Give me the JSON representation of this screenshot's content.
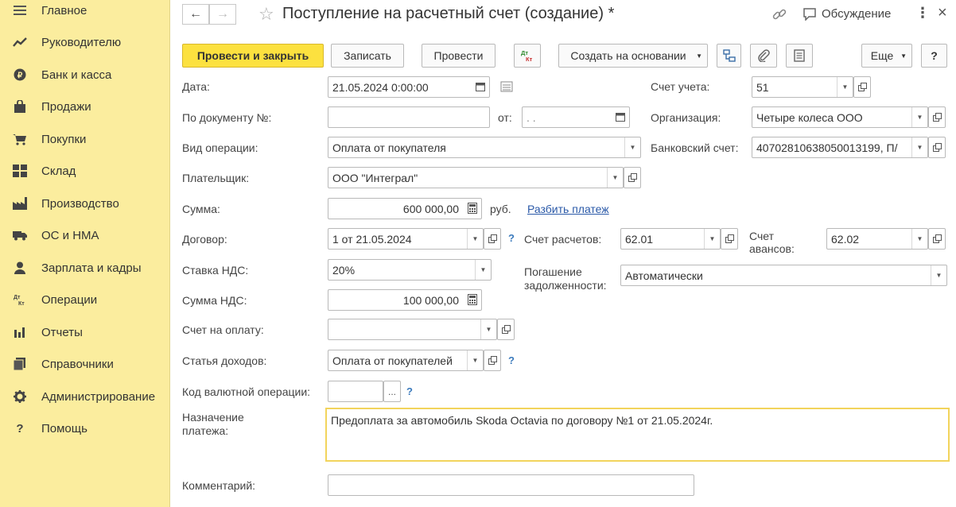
{
  "sidebar": {
    "items": [
      {
        "label": "Главное",
        "icon": "menu-icon"
      },
      {
        "label": "Руководителю",
        "icon": "trend-icon"
      },
      {
        "label": "Банк и касса",
        "icon": "coin-icon"
      },
      {
        "label": "Продажи",
        "icon": "bag-icon"
      },
      {
        "label": "Покупки",
        "icon": "cart-icon"
      },
      {
        "label": "Склад",
        "icon": "warehouse-icon"
      },
      {
        "label": "Производство",
        "icon": "factory-icon"
      },
      {
        "label": "ОС и НМА",
        "icon": "truck-icon"
      },
      {
        "label": "Зарплата и кадры",
        "icon": "person-icon"
      },
      {
        "label": "Операции",
        "icon": "dt-kt-icon"
      },
      {
        "label": "Отчеты",
        "icon": "bar-chart-icon"
      },
      {
        "label": "Справочники",
        "icon": "books-icon"
      },
      {
        "label": "Администрирование",
        "icon": "gear-icon"
      },
      {
        "label": "Помощь",
        "icon": "question-icon"
      }
    ]
  },
  "header": {
    "title": "Поступление на расчетный счет (создание) *",
    "discussion_label": "Обсуждение"
  },
  "toolbar": {
    "post_close": "Провести и закрыть",
    "save": "Записать",
    "post": "Провести",
    "dt_kt": "Дт Кт",
    "create_based": "Создать на основании",
    "more": "Еще",
    "help": "?"
  },
  "form": {
    "date_label": "Дата:",
    "date_value": "21.05.2024  0:00:00",
    "doc_no_label": "По документу №:",
    "doc_no_value": "",
    "from_label": "от:",
    "from_value": " .  .",
    "op_type_label": "Вид операции:",
    "op_type_value": "Оплата от покупателя",
    "payer_label": "Плательщик:",
    "payer_value": "ООО \"Интеграл\"",
    "sum_label": "Сумма:",
    "sum_value": "600 000,00",
    "currency": "руб.",
    "split_link": "Разбить платеж",
    "contract_label": "Договор:",
    "contract_value": "1 от 21.05.2024",
    "vat_rate_label": "Ставка НДС:",
    "vat_rate_value": "20%",
    "vat_sum_label": "Сумма НДС:",
    "vat_sum_value": "100 000,00",
    "invoice_label": "Счет на оплату:",
    "invoice_value": "",
    "income_item_label": "Статья доходов:",
    "income_item_value": "Оплата от покупателей",
    "fx_code_label": "Код валютной операции:",
    "fx_code_value": "",
    "fx_code_btn": "...",
    "purpose_label": "Назначение платежа:",
    "purpose_value": "Предоплата за автомобиль Skoda Octavia по договору №1 от 21.05.2024г.",
    "comment_label": "Комментарий:",
    "comment_value": "",
    "account_label": "Счет учета:",
    "account_value": "51",
    "org_label": "Организация:",
    "org_value": "Четыре колеса ООО",
    "bank_acc_label": "Банковский счет:",
    "bank_acc_value": "40702810638050013199, П/",
    "settle_acc_label": "Счет расчетов:",
    "settle_acc_value": "62.01",
    "adv_acc_label": "Счет авансов:",
    "adv_acc_value": "62.02",
    "repay_label": "Погашение задолженности:",
    "repay_value": "Автоматически",
    "help_mark": "?"
  }
}
